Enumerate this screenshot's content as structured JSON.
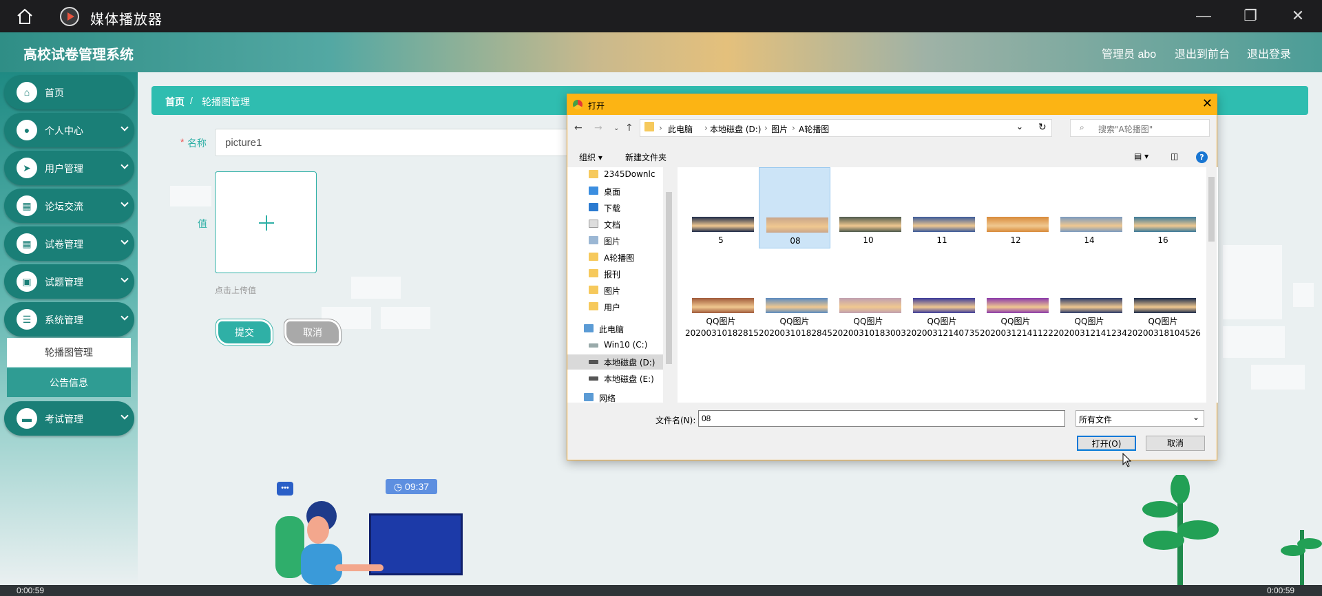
{
  "window": {
    "title": "媒体播放器",
    "minimize": "—",
    "maximize": "❐",
    "close": "✕"
  },
  "header": {
    "title": "高校试卷管理系统",
    "user": "管理员 abo",
    "to_front": "退出到前台",
    "logout": "退出登录"
  },
  "sidebar": {
    "items": [
      {
        "label": "首页",
        "icon": "home-icon"
      },
      {
        "label": "个人中心",
        "icon": "person-icon"
      },
      {
        "label": "用户管理",
        "icon": "send-icon"
      },
      {
        "label": "论坛交流",
        "icon": "grid-icon"
      },
      {
        "label": "试卷管理",
        "icon": "grid-icon"
      },
      {
        "label": "试题管理",
        "icon": "briefcase-icon"
      },
      {
        "label": "系统管理",
        "icon": "settings-sliders-icon"
      },
      {
        "label": "考试管理",
        "icon": "monitor-icon"
      }
    ],
    "sub_items": [
      {
        "label": "轮播图管理"
      },
      {
        "label": "公告信息"
      }
    ]
  },
  "breadcrumb": {
    "home": "首页",
    "sep": "/",
    "current": "轮播图管理"
  },
  "form": {
    "name_label": "名称",
    "required_mark": "*",
    "name_value": "picture1",
    "value_label": "值",
    "upload_hint": "点击上传值",
    "submit": "提交",
    "cancel": "取消"
  },
  "illustration": {
    "clock": "09:37",
    "bubble": "•••"
  },
  "dialog": {
    "title": "打开",
    "address": [
      "此电脑",
      "本地磁盘 (D:)",
      "图片",
      "A轮播图"
    ],
    "search_placeholder": "搜索\"A轮播图\"",
    "organize": "组织 ▾",
    "new_folder": "新建文件夹",
    "help": "?",
    "tree": [
      {
        "label": "2345Downlc",
        "pinned": true
      },
      {
        "label": "桌面",
        "pinned": true
      },
      {
        "label": "下载",
        "pinned": true
      },
      {
        "label": "文档",
        "pinned": true
      },
      {
        "label": "图片",
        "pinned": true
      },
      {
        "label": "A轮播图",
        "pinned": false
      },
      {
        "label": "报刊",
        "pinned": false
      },
      {
        "label": "图片",
        "pinned": false
      },
      {
        "label": "用户",
        "pinned": false
      },
      {
        "label": "此电脑",
        "pinned": false
      },
      {
        "label": "Win10 (C:)",
        "pinned": false
      },
      {
        "label": "本地磁盘 (D:)",
        "pinned": false,
        "selected": true
      },
      {
        "label": "本地磁盘 (E:)",
        "pinned": false
      },
      {
        "label": "网络",
        "pinned": false
      }
    ],
    "files": [
      {
        "name": "5",
        "color": "#1d2b4a"
      },
      {
        "name": "08",
        "color": "#c9a58a",
        "selected": true
      },
      {
        "name": "10",
        "color": "#4d5a4d"
      },
      {
        "name": "11",
        "color": "#3a5a9a"
      },
      {
        "name": "12",
        "color": "#d88a3a"
      },
      {
        "name": "14",
        "color": "#7a9ac0"
      },
      {
        "name": "16",
        "color": "#3a7a9a"
      },
      {
        "name": "QQ图片20200310182815",
        "color": "#a05a3a"
      },
      {
        "name": "QQ图片20200310182845",
        "color": "#5a8ac0"
      },
      {
        "name": "QQ图片20200310183003",
        "color": "#c0a0b0"
      },
      {
        "name": "QQ图片20200312140735",
        "color": "#3a3a9a"
      },
      {
        "name": "QQ图片20200312141122",
        "color": "#8a3aaa"
      },
      {
        "name": "QQ图片20200312141234",
        "color": "#2a3a6a"
      },
      {
        "name": "QQ图片20200318104526",
        "color": "#1a2a4a"
      }
    ],
    "filename_label": "文件名(N):",
    "filename_value": "08",
    "filetype": "所有文件",
    "open_button": "打开(O)",
    "cancel_button": "取消"
  },
  "bottom": {
    "left_time": "0:00:59",
    "right_time": "0:00:59"
  }
}
